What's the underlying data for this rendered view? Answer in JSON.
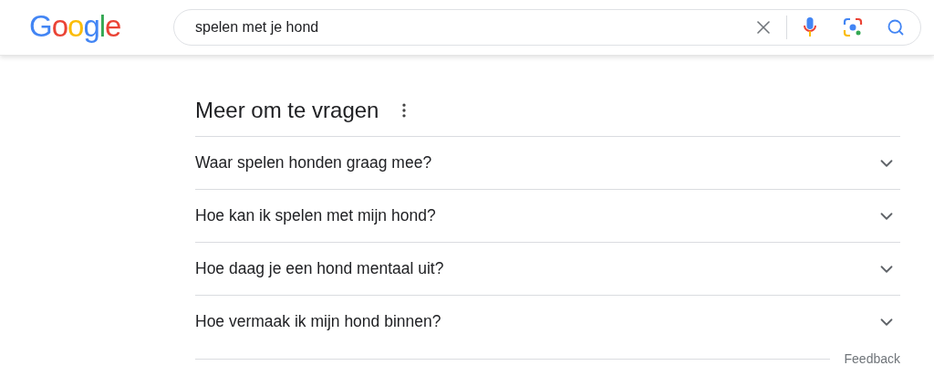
{
  "header": {
    "logo": "Google",
    "search": {
      "value": "spelen met je hond"
    }
  },
  "related_questions": {
    "title": "Meer om te vragen",
    "questions": [
      {
        "text": "Waar spelen honden graag mee?",
        "expanded": false
      },
      {
        "text": "Hoe kan ik spelen met mijn hond?",
        "expanded": false
      },
      {
        "text": "Hoe daag je een hond mentaal uit?",
        "expanded": false
      },
      {
        "text": "Hoe vermaak ik mijn hond binnen?",
        "expanded": false
      }
    ],
    "feedback": "Feedback"
  }
}
